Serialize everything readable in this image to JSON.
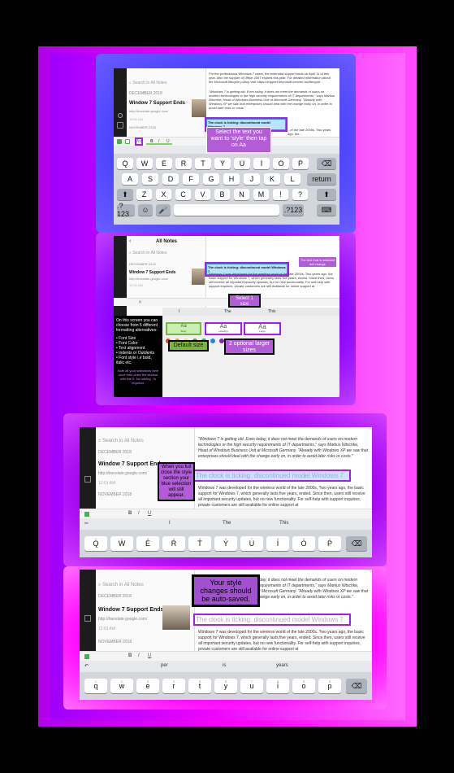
{
  "panel1": {
    "search_placeholder": "Search in All Notes",
    "list_date": "DECEMBER 2018",
    "note_title": "Window 7 Support Ends",
    "note_url": "http://translate.google.com/",
    "note_time": "12:01 AM",
    "list_date2": "NOVEMBER 2018",
    "body_top": "For the professional Windows 7 users, the extended support ends on April 11 of this year. Also the support of Office 2007 expires this year. For detailed information about the Microsoft lifecycle policy, visit https://support.microsoft.com/en-us/lifecycle.",
    "body_quote": "\"Windows 7 is getting old. Even today, it does not meet the demands of users on modern technologies or the high security requirements of IT departments,\" says Markus Nitschke, Head of Windows Business Unit at Microsoft Germany. \"Already with Windows XP we saw that enterprises should deal with the change early on, in order to avoid later risks or costs.\"",
    "selected_text": "The clock is ticking: discontinued model Windows 7",
    "body_after": "...of the late 2000s. Two years ago, the...",
    "annotation": "Select the text you want to 'style' then tap on Aa",
    "aa_label": "Aa",
    "kb_row1": [
      "Q",
      "W",
      "E",
      "R",
      "T",
      "Y",
      "U",
      "I",
      "O",
      "P"
    ],
    "kb_row2": [
      "A",
      "S",
      "D",
      "F",
      "G",
      "H",
      "J",
      "K",
      "L"
    ],
    "kb_row3": [
      "Z",
      "X",
      "C",
      "V",
      "B",
      "N",
      "M",
      "!",
      "?"
    ],
    "kb_nums1": [
      "1",
      "2",
      "3",
      "4",
      "5",
      "6",
      "7",
      "8",
      "9",
      "0"
    ],
    "return_label": "return",
    "num_label": ".?123"
  },
  "panel2": {
    "header_title": "All Notes",
    "search_placeholder": "Search in All Notes",
    "list_date": "DECEMBER 2018",
    "note_title": "Window 7 Support Ends",
    "note_url": "http://translate.google.com/",
    "note_time": "12:01 AM",
    "selected_text": "The clock is ticking: discontinued model Windows 7",
    "body_after": "Windows 7 was developed for the wireless world of the late 2000s. Two years ago, the basic support for Windows 7, which generally lasts five years, ended. Since then, users still receive all important security updates, but no new functionality. For self-help with support inquiries, private customers are still available for online support at",
    "tip_note": "The text that is selected will change",
    "side_info_lines": [
      "On this screen you can choose from 5 different formatting alternatives:",
      "",
      "• Font Size",
      "• Font Color",
      "• Text alignment",
      "• Indents or Outdents",
      "• Font style i.e bold, italic etc."
    ],
    "side_info_note": "Note all your selections here once then close the section with the X. No saving - is required.",
    "select_label": "Select 1 size",
    "size_options": [
      {
        "sample": "Aa",
        "label": "Body"
      },
      {
        "sample": "Aa",
        "label": "Heading"
      },
      {
        "sample": "Aa",
        "label": "Large"
      }
    ],
    "default_label": "Default size",
    "optional_label": "2 optional larger sizes",
    "suggestions": [
      "I",
      "The",
      "This"
    ],
    "colors": [
      "#e53935",
      "#ff9800",
      "#fdd835",
      "#43a047",
      "#00acc1",
      "#1e88e5",
      "#8e24aa",
      "#e91e63",
      "#212121",
      "#9e9e9e",
      "#bdbdbd",
      "#e0e0e0"
    ]
  },
  "panel3": {
    "search_placeholder": "Search in All Notes",
    "list_date": "DECEMBER 2018",
    "note_title": "Window 7 Support Ends",
    "note_url": "http://translate.google.com/",
    "note_time": "12:01 AM",
    "list_date2": "NOVEMBER 2018",
    "body_quote": "\"Windows 7 is getting old. Even today, it does not meet the demands of users on modern technologies or the high security requirements of IT departments,\" says Markus Nitschke, Head of Windows Business Unit at Microsoft Germany. \"Already with Windows XP we saw that enterprises should deal with the change early on, in order to avoid later risks or costs.\"",
    "styled_text": "The clock is ticking: discontinued model Windows 7",
    "body_after": "Windows 7 was developed for the wireless world of the late 2000s. Two years ago, the basic support for Windows 7, which generally lasts five years, ended. Since then, users still receive all important security updates, but no new functionality. For self-help with support inquiries, private customers are still available for online support at",
    "annotation": "When you full close the style section your blue selection will still appear.",
    "suggestions": [
      "I",
      "The",
      "This"
    ],
    "kb_row1": [
      "Q",
      "W",
      "E",
      "R",
      "T",
      "Y",
      "U",
      "I",
      "O",
      "P"
    ],
    "kb_nums1": [
      "1",
      "2",
      "3",
      "4",
      "5",
      "6",
      "7",
      "8",
      "9",
      "0"
    ]
  },
  "panel4": {
    "search_placeholder": "Search in All Notes",
    "list_date": "DECEMBER 2018",
    "note_title": "Window 7 Support Ends",
    "note_url": "http://translate.google.com/",
    "note_time": "12:01 AM",
    "list_date2": "NOVEMBER 2018",
    "body_quote": "\"Windows 7 is getting old. Even today, it does not meet the demands of users on modern technologies or the high security requirements of IT departments,\" says Markus Nitschke, Head of Windows Business Unit at Microsoft Germany. \"Already with Windows XP we saw that enterprises should deal with the change early on, in order to avoid later risks or costs.\"",
    "styled_text": "The clock is ticking: discontinued model Windows 7",
    "body_after": "Windows 7 was developed for the wireless world of the late 2000s. Two years ago, the basic support for Windows 7, which generally lasts five years, ended. Since then, users still receive all important security updates, but no new functionality. For self-help with support inquiries, private customers are still available for online support at",
    "annotation": "Your style changes should be auto-saved.",
    "suggestions": [
      "per",
      "is",
      "years"
    ],
    "kb_row1": [
      "q",
      "w",
      "e",
      "r",
      "t",
      "y",
      "u",
      "i",
      "o",
      "p"
    ],
    "kb_nums1": [
      "1",
      "2",
      "3",
      "4",
      "5",
      "6",
      "7",
      "8",
      "9",
      "0"
    ]
  },
  "format_toolbar": [
    "B",
    "I",
    "U",
    "S"
  ]
}
